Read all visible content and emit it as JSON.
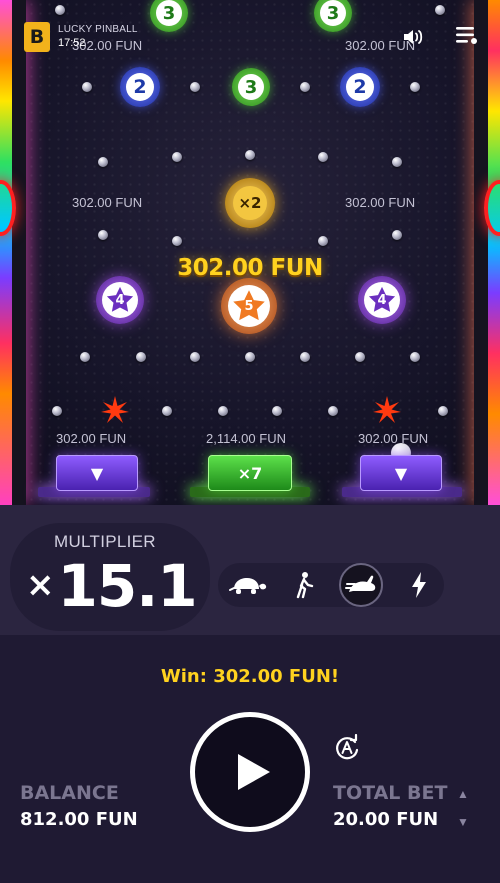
{
  "header": {
    "logo": "B",
    "title": "LUCKY PINBALL",
    "time": "17:52",
    "icons": {
      "sound": "speaker-icon",
      "menu": "menu-icon"
    }
  },
  "board": {
    "tokens": {
      "t3a": "3",
      "t3b": "3",
      "t3c": "3",
      "t2a": "2",
      "t2b": "2",
      "x2": "×2",
      "s4a": "4",
      "s5": "5",
      "s4b": "4"
    },
    "labels": {
      "tl": "302.00 FUN",
      "tr": "302.00 FUN",
      "ml": "302.00 FUN",
      "mr": "302.00 FUN",
      "bl": "302.00 FUN",
      "bc": "2,114.00 FUN",
      "br": "302.00 FUN"
    },
    "win_float": "302.00 FUN",
    "buckets": {
      "left": "▼",
      "center": "×7",
      "right": "▼"
    },
    "colors": {
      "gold": "#ffd21f",
      "purple_bucket": "#8e5cff",
      "green_bucket": "#5ce04a",
      "bumper": "#ff2020"
    }
  },
  "multiplier": {
    "label": "MULTIPLIER",
    "prefix": "×",
    "value": "15.1"
  },
  "speed": {
    "options": [
      "turtle-icon",
      "walk-icon",
      "rabbit-icon",
      "lightning-icon"
    ],
    "selected": "rabbit-icon"
  },
  "controls": {
    "win_message": "Win: 302.00 FUN!",
    "balance_label": "BALANCE",
    "balance_value": "812.00 FUN",
    "bet_label": "TOTAL BET",
    "bet_value": "20.00 FUN"
  }
}
